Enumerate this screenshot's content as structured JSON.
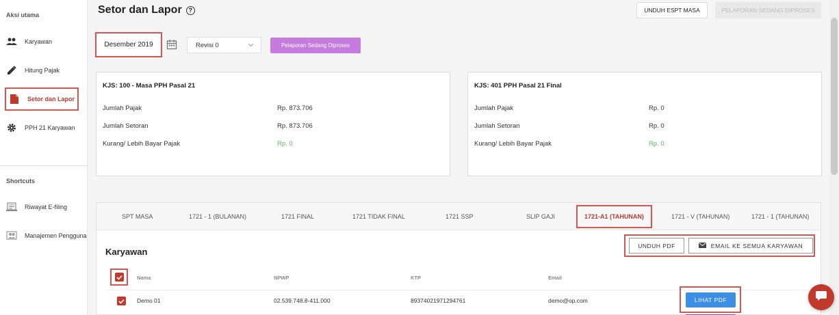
{
  "sidebar": {
    "section_main": "Aksi utama",
    "items": [
      {
        "label": "Karyawan",
        "icon": "people-icon"
      },
      {
        "label": "Hitung Pajak",
        "icon": "pencil-icon"
      },
      {
        "label": "Setor dan Lapor",
        "icon": "document-icon"
      },
      {
        "label": "PPH 21 Karyawan",
        "icon": "gear-icon"
      }
    ],
    "section_shortcuts": "Shortcuts",
    "shortcuts": [
      {
        "label": "Riwayat E-filing",
        "icon": "efiling-icon"
      },
      {
        "label": "Manajemen Pengguna",
        "icon": "users-icon"
      }
    ]
  },
  "header": {
    "title": "Setor dan Lapor",
    "help": "?",
    "unduh_espt": "UNDUH ESPT MASA",
    "pelaporan_top": "PELAPORAN SEDANG DIPROSES"
  },
  "filters": {
    "month": "Desember 2019",
    "revisi": "Revisi 0",
    "pelaporan_btn": "Pelaporan Sedang Diproses"
  },
  "kjs": [
    {
      "title": "KJS: 100 - Masa PPH Pasal 21",
      "jumlah_pajak_label": "Jumlah Pajak",
      "jumlah_pajak": "Rp. 873.706",
      "jumlah_setoran_label": "Jumlah Setoran",
      "jumlah_setoran": "Rp. 873.706",
      "kurang_label": "Kurang/ Lebih Bayar Pajak",
      "kurang": "Rp. 0"
    },
    {
      "title": "KJS: 401 PPH Pasal 21 Final",
      "jumlah_pajak_label": "Jumlah Pajak",
      "jumlah_pajak": "Rp. 0",
      "jumlah_setoran_label": "Jumlah Setoran",
      "jumlah_setoran": "Rp. 0",
      "kurang_label": "Kurang/ Lebih Bayar Pajak",
      "kurang": "Rp. 0"
    }
  ],
  "tabs": [
    {
      "label": "SPT MASA"
    },
    {
      "label": "1721 - 1 (BULANAN)"
    },
    {
      "label": "1721 FINAL"
    },
    {
      "label": "1721 TIDAK FINAL"
    },
    {
      "label": "1721 SSP"
    },
    {
      "label": "SLIP GAJI"
    },
    {
      "label": "1721-A1 (TAHUNAN)"
    },
    {
      "label": "1721 - V (TAHUNAN)"
    },
    {
      "label": "1721 - 1 (TAHUNAN)"
    }
  ],
  "karyawan": {
    "title": "Karyawan",
    "unduh_pdf": "UNDUH PDF",
    "email_all": "EMAIL KE SEMUA KARYAWAN",
    "columns": {
      "nama": "Nama",
      "npwp": "NPWP",
      "ktp": "KTP",
      "email": "Email"
    },
    "rows": [
      {
        "nama": "Demo 01",
        "npwp": "02.539.748.8-411.000",
        "ktp": "89374021971294761",
        "email": "demo@op.com",
        "action": "LIHAT PDF"
      }
    ]
  },
  "colors": {
    "accent_red": "#c0392b",
    "purple": "#c57be0",
    "blue": "#3d8fe6",
    "green": "#5cb85c"
  }
}
